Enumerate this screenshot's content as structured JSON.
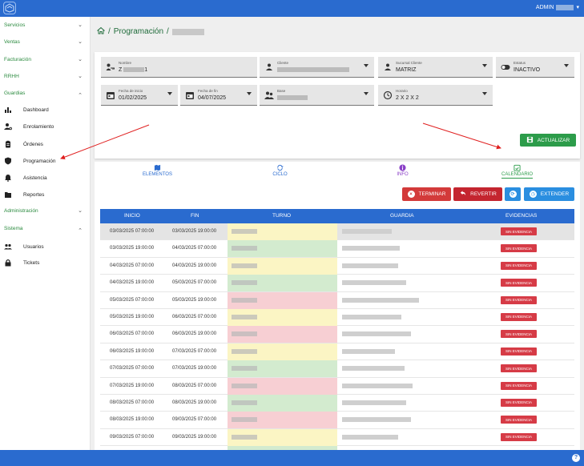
{
  "topbar": {
    "user_label": "ADMIN"
  },
  "sidebar": {
    "sections": [
      {
        "label": "Servicios",
        "chevron": "chevron-down"
      },
      {
        "label": "Ventas",
        "chevron": "chevron-down"
      },
      {
        "label": "Facturación",
        "chevron": "chevron-down"
      },
      {
        "label": "RRHH",
        "chevron": "chevron-down"
      },
      {
        "label": "Guardias",
        "chevron": "chevron-up"
      },
      {
        "label": "Administración",
        "chevron": "chevron-down"
      },
      {
        "label": "Sistema",
        "chevron": "chevron-up"
      }
    ],
    "guardias_items": [
      {
        "label": "Dashboard",
        "icon": "bar-chart-icon"
      },
      {
        "label": "Enrolamiento",
        "icon": "user-gear-icon"
      },
      {
        "label": "Órdenes",
        "icon": "clipboard-icon"
      },
      {
        "label": "Programación",
        "icon": "shield-icon"
      },
      {
        "label": "Asistencia",
        "icon": "bell-icon"
      },
      {
        "label": "Reportes",
        "icon": "folder-icon"
      }
    ],
    "sistema_items": [
      {
        "label": "Usuarios",
        "icon": "users-icon"
      },
      {
        "label": "Tickets",
        "icon": "lock-icon"
      }
    ]
  },
  "breadcrumb": {
    "sep1": "/",
    "title": "Programación",
    "sep2": "/"
  },
  "filters": {
    "nombre": {
      "label": "Nombre",
      "value_prefix": "Z",
      "value_suffix": "1"
    },
    "cliente": {
      "label": "Cliente"
    },
    "sucursal": {
      "label": "Sucursal Cliente",
      "value": "MATRIZ"
    },
    "estatus": {
      "label": "Estatus",
      "value": "INACTIVO"
    },
    "fecha_inicio": {
      "label": "Fecha de inicio",
      "value": "01/02/2025"
    },
    "fecha_fin": {
      "label": "Fecha de fin",
      "value": "04/07/2025"
    },
    "base": {
      "label": "Base"
    },
    "horario": {
      "label": "Horario",
      "value": "2 X 2 X 2"
    }
  },
  "actualizar_label": "ACTUALIZAR",
  "tabs": [
    {
      "label": "ELEMENTOS",
      "color": "#2a6bcf"
    },
    {
      "label": "CICLO",
      "color": "#2a6bcf"
    },
    {
      "label": "INFO",
      "color": "#8a3fc7"
    },
    {
      "label": "CALENDARIO",
      "color": "#2c9c4a"
    }
  ],
  "actions": {
    "terminar": "TERMINAR",
    "revertir": "REVERTIR",
    "extender": "EXTENDER"
  },
  "table": {
    "headers": [
      "INICIO",
      "FIN",
      "TURNO",
      "GUARDIA",
      "EVIDENCIAS"
    ],
    "rows": [
      {
        "inicio": "03/03/2025 07:00:00",
        "fin": "03/03/2025 19:00:00",
        "color": "#fbf5c4",
        "evidencia": "SIN EVIDENCIA"
      },
      {
        "inicio": "03/03/2025 19:00:00",
        "fin": "04/03/2025 07:00:00",
        "color": "#d3ebcf",
        "evidencia": "SIN EVIDENCIA"
      },
      {
        "inicio": "04/03/2025 07:00:00",
        "fin": "04/03/2025 19:00:00",
        "color": "#fbf5c4",
        "evidencia": "SIN EVIDENCIA"
      },
      {
        "inicio": "04/03/2025 19:00:00",
        "fin": "05/03/2025 07:00:00",
        "color": "#d3ebcf",
        "evidencia": "SIN EVIDENCIA"
      },
      {
        "inicio": "05/03/2025 07:00:00",
        "fin": "05/03/2025 19:00:00",
        "color": "#f7cfd3",
        "evidencia": "SIN EVIDENCIA"
      },
      {
        "inicio": "05/03/2025 19:00:00",
        "fin": "06/03/2025 07:00:00",
        "color": "#fbf5c4",
        "evidencia": "SIN EVIDENCIA"
      },
      {
        "inicio": "06/03/2025 07:00:00",
        "fin": "06/03/2025 19:00:00",
        "color": "#f7cfd3",
        "evidencia": "SIN EVIDENCIA"
      },
      {
        "inicio": "06/03/2025 19:00:00",
        "fin": "07/03/2025 07:00:00",
        "color": "#fbf5c4",
        "evidencia": "SIN EVIDENCIA"
      },
      {
        "inicio": "07/03/2025 07:00:00",
        "fin": "07/03/2025 19:00:00",
        "color": "#d3ebcf",
        "evidencia": "SIN EVIDENCIA"
      },
      {
        "inicio": "07/03/2025 19:00:00",
        "fin": "08/03/2025 07:00:00",
        "color": "#f7cfd3",
        "evidencia": "SIN EVIDENCIA"
      },
      {
        "inicio": "08/03/2025 07:00:00",
        "fin": "08/03/2025 19:00:00",
        "color": "#d3ebcf",
        "evidencia": "SIN EVIDENCIA"
      },
      {
        "inicio": "08/03/2025 19:00:00",
        "fin": "09/03/2025 07:00:00",
        "color": "#f7cfd3",
        "evidencia": "SIN EVIDENCIA"
      },
      {
        "inicio": "09/03/2025 07:00:00",
        "fin": "09/03/2025 19:00:00",
        "color": "#fbf5c4",
        "evidencia": "SIN EVIDENCIA"
      },
      {
        "inicio": "09/03/2025 19:00:00",
        "fin": "10/03/2025 07:00:00",
        "color": "#d3ebcf",
        "evidencia": "SIN EVIDENCIA"
      }
    ]
  },
  "help_label": "?"
}
